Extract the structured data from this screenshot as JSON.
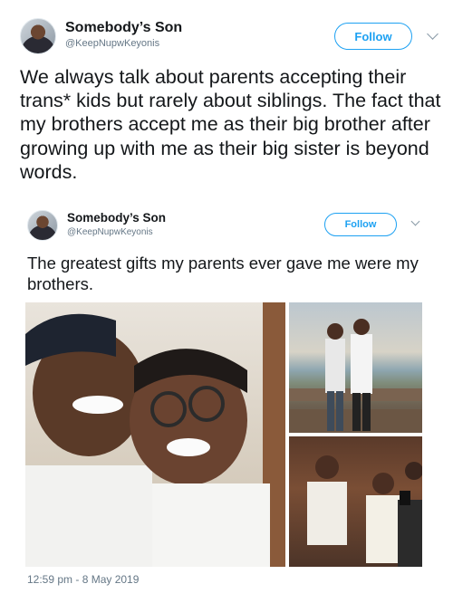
{
  "tweet1": {
    "display_name": "Somebody’s Son",
    "handle": "@KeepNupwKeyonis",
    "follow_label": "Follow",
    "text": "We always talk about parents accepting their trans* kids but rarely about siblings. The fact that my brothers accept me as their big brother after growing up with me as their big sister is beyond words."
  },
  "tweet2": {
    "display_name": "Somebody’s Son",
    "handle": "@KeepNupwKeyonis",
    "follow_label": "Follow",
    "text": "The greatest gifts my parents ever gave me were my brothers.",
    "timestamp": "12:59 pm - 8 May 2019"
  },
  "colors": {
    "accent": "#1da1f2",
    "text": "#14171a",
    "secondary": "#657786"
  },
  "icons": {
    "menu": "chevron-down-icon"
  }
}
